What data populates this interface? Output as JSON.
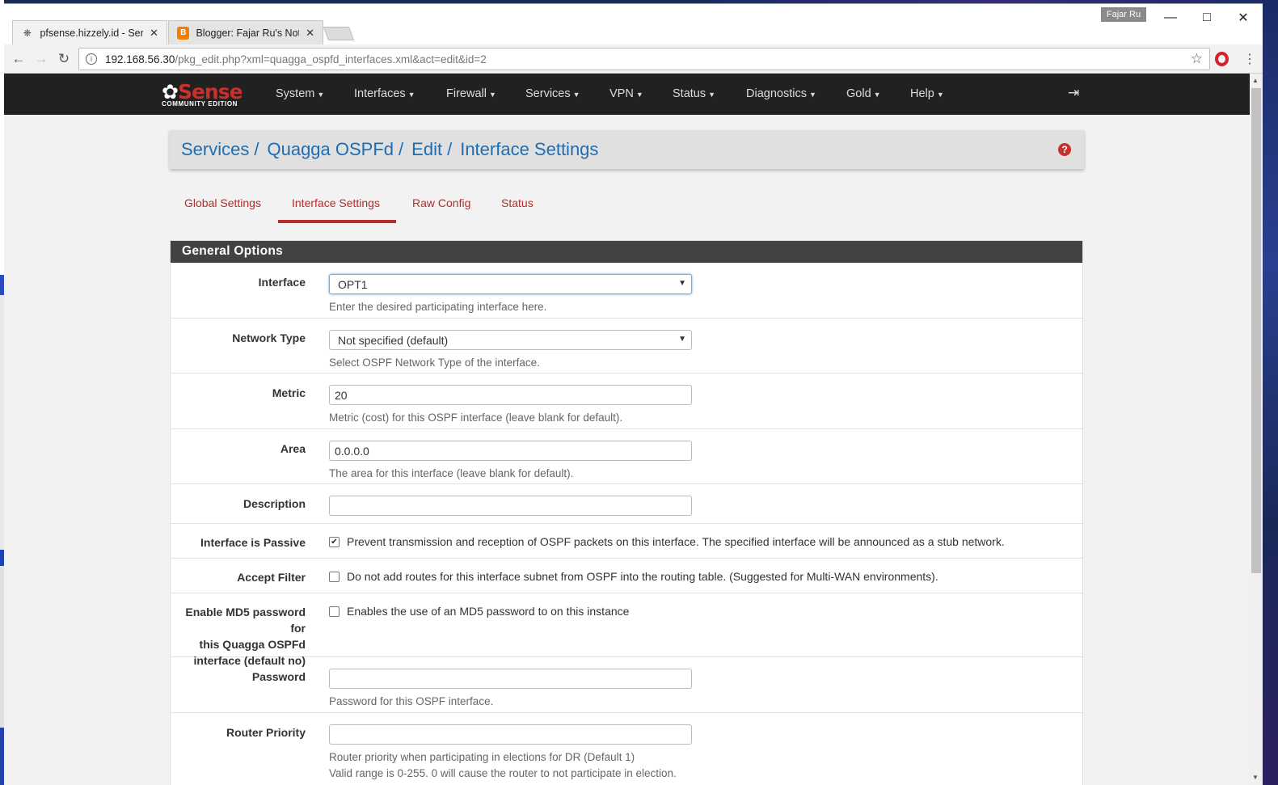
{
  "browser": {
    "tabs": [
      {
        "title": "pfsense.hizzely.id - Servic",
        "favicon": "pfsense-icon",
        "active": true
      },
      {
        "title": "Blogger: Fajar Ru's Note",
        "favicon": "blogger-icon",
        "active": false
      }
    ],
    "profile_name": "Fajar Ru",
    "url_host": "192.168.56.30",
    "url_path": "/pkg_edit.php?xml=quagga_ospfd_interfaces.xml&act=edit&id=2"
  },
  "navbar": {
    "logo_word": "Sense",
    "logo_sub": "COMMUNITY EDITION",
    "items": [
      "System",
      "Interfaces",
      "Firewall",
      "Services",
      "VPN",
      "Status",
      "Diagnostics",
      "Gold",
      "Help"
    ]
  },
  "breadcrumb": [
    "Services",
    "Quagga OSPFd",
    "Edit",
    "Interface Settings"
  ],
  "tabs": [
    "Global Settings",
    "Interface Settings",
    "Raw Config",
    "Status"
  ],
  "active_tab": "Interface Settings",
  "panel": {
    "title": "General Options",
    "fields": {
      "interface": {
        "label": "Interface",
        "value": "OPT1",
        "hint": "Enter the desired participating interface here."
      },
      "network_type": {
        "label": "Network Type",
        "value": "Not specified (default)",
        "hint": "Select OSPF Network Type of the interface."
      },
      "metric": {
        "label": "Metric",
        "value": "20",
        "hint": "Metric (cost) for this OSPF interface (leave blank for default)."
      },
      "area": {
        "label": "Area",
        "value": "0.0.0.0",
        "hint": "The area for this interface (leave blank for default)."
      },
      "description": {
        "label": "Description",
        "value": ""
      },
      "passive": {
        "label": "Interface is Passive",
        "checked": true,
        "text": "Prevent transmission and reception of OSPF packets on this interface. The specified interface will be announced as a stub network."
      },
      "accept_filter": {
        "label": "Accept Filter",
        "checked": false,
        "text": "Do not add routes for this interface subnet from OSPF into the routing table. (Suggested for Multi-WAN environments)."
      },
      "md5": {
        "label_lines": [
          "Enable MD5 password for",
          "this Quagga OSPFd",
          "interface (default no)"
        ],
        "checked": false,
        "text": "Enables the use of an MD5 password to on this instance"
      },
      "password": {
        "label": "Password",
        "value": "",
        "hint": "Password for this OSPF interface."
      },
      "router_priority": {
        "label": "Router Priority",
        "value": "",
        "hint_lines": [
          "Router priority when participating in elections for DR (Default 1)",
          "Valid range is 0-255. 0 will cause the router to not participate in election."
        ]
      }
    }
  },
  "colors": {
    "accent": "#b32d2a",
    "link": "#1e6db3",
    "navbar": "#212121",
    "panel_head": "#424242"
  }
}
